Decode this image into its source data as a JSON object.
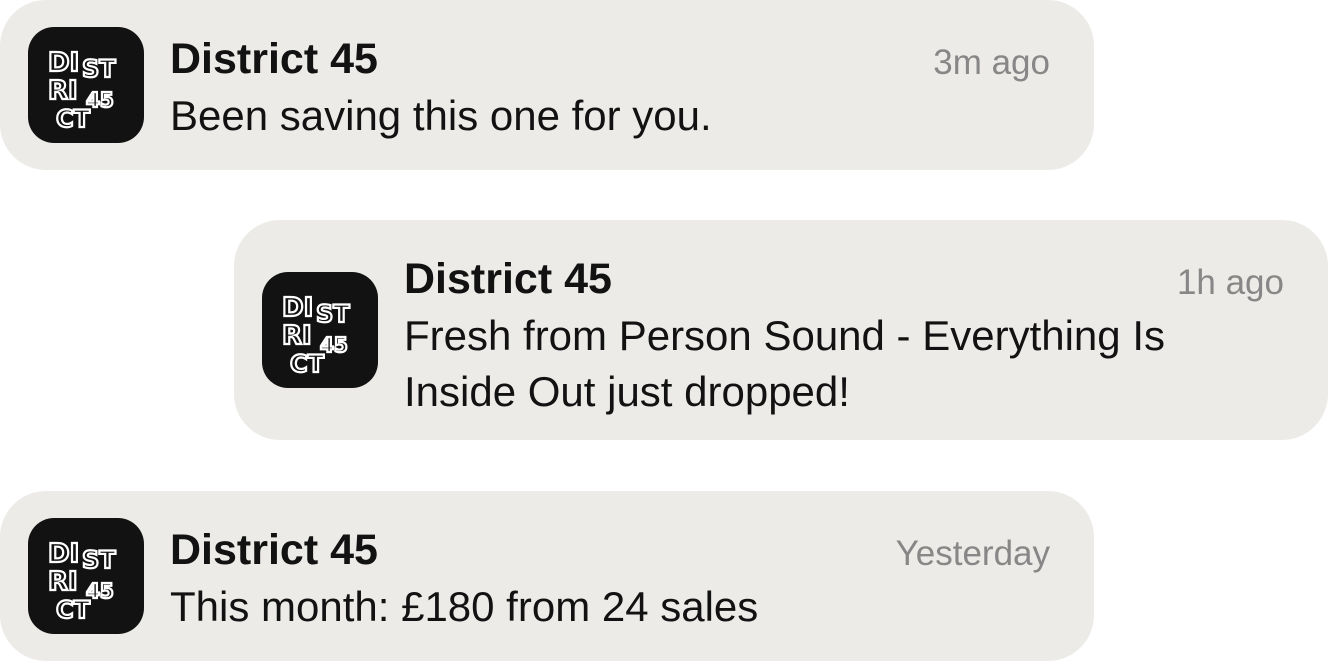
{
  "notifications": [
    {
      "app_name": "District 45",
      "time": "3m ago",
      "message": "Been saving this one for you.",
      "icon": "district-45-logo-icon"
    },
    {
      "app_name": "District 45",
      "time": "1h ago",
      "message": "Fresh from Person Sound - Everything Is Inside Out just dropped!",
      "icon": "district-45-logo-icon"
    },
    {
      "app_name": "District 45",
      "time": "Yesterday",
      "message": "This month: £180 from 24 sales",
      "icon": "district-45-logo-icon"
    }
  ],
  "logo": {
    "line1": "DI",
    "line1b": "ST",
    "line2": "RI",
    "line2b": "45",
    "line3": "CT"
  },
  "colors": {
    "card_background": "#ecebe8",
    "icon_background": "#121212",
    "text_primary": "#121212",
    "text_secondary": "#878787"
  }
}
